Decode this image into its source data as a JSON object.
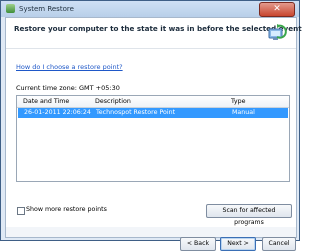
{
  "window": {
    "title": "System Restore",
    "close_label": "✕"
  },
  "header": {
    "heading": "Restore your computer to the state it was in before the selected event"
  },
  "help": {
    "link": "How do I choose a restore point?"
  },
  "timezone": {
    "text": "Current time zone: GMT +05:30"
  },
  "table": {
    "columns": [
      "Date and Time",
      "Description",
      "Type"
    ],
    "rows": [
      {
        "datetime": "26-01-2011 22:06:24",
        "description": "Technospot Restore Point",
        "type": "Manual"
      }
    ]
  },
  "options": {
    "show_more_label": "Show more restore points"
  },
  "buttons": {
    "scan": "Scan for affected programs",
    "back": "< Back",
    "next": "Next >",
    "cancel": "Cancel"
  },
  "colors": {
    "selection": "#3399ff",
    "link": "#1f58c8",
    "close": "#c8462f"
  },
  "icons": {
    "app": "system-restore-icon",
    "hero": "computer-restore-icon"
  }
}
